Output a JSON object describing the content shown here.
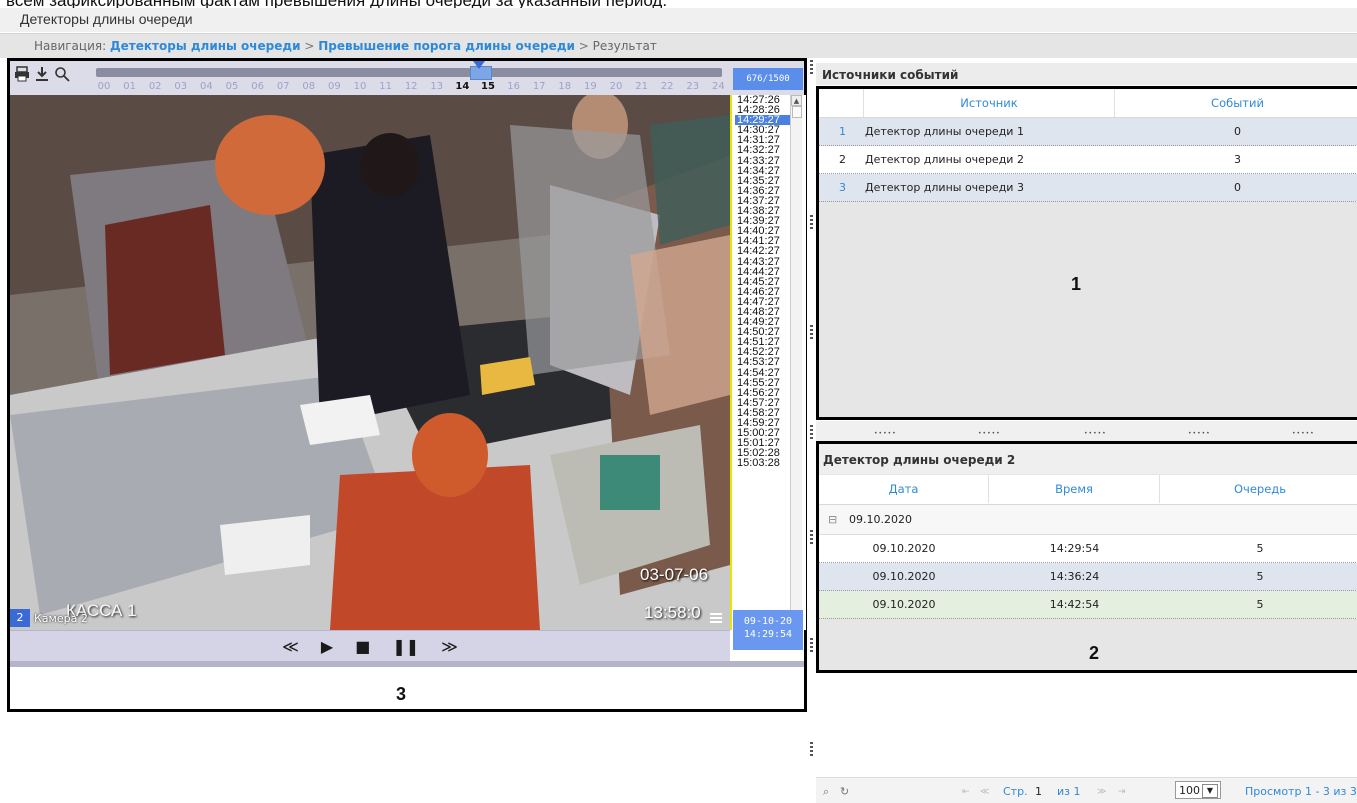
{
  "top_caption": "всем зафиксированным фактам превышения длины очереди за указанный период.",
  "page_title": "Детекторы длины очереди",
  "breadcrumb": {
    "prefix": "Навигация:",
    "link1": "Детекторы длины очереди",
    "sep": ">",
    "link2": "Превышение порога длины очереди",
    "current": "Результат"
  },
  "player": {
    "frame_counter": "676/1500",
    "hours": [
      "00",
      "01",
      "02",
      "03",
      "04",
      "05",
      "06",
      "07",
      "08",
      "09",
      "10",
      "11",
      "12",
      "13",
      "14",
      "15",
      "16",
      "17",
      "18",
      "19",
      "20",
      "21",
      "22",
      "23",
      "24"
    ],
    "highlighted_hours": [
      "14",
      "15"
    ],
    "times": [
      "14:27:26",
      "14:28:26",
      "14:29:27",
      "14:30:27",
      "14:31:27",
      "14:32:27",
      "14:33:27",
      "14:34:27",
      "14:35:27",
      "14:36:27",
      "14:37:27",
      "14:38:27",
      "14:39:27",
      "14:40:27",
      "14:41:27",
      "14:42:27",
      "14:43:27",
      "14:44:27",
      "14:45:27",
      "14:46:27",
      "14:47:27",
      "14:48:27",
      "14:49:27",
      "14:50:27",
      "14:51:27",
      "14:52:27",
      "14:53:27",
      "14:54:27",
      "14:55:27",
      "14:56:27",
      "14:57:27",
      "14:58:27",
      "14:59:27",
      "15:00:27",
      "15:01:27",
      "15:02:28",
      "15:03:28"
    ],
    "selected_time_index": 2,
    "camera_number": "2",
    "camera_name": "Камера 2",
    "osd_kassa": "КАССА 1",
    "osd_date": "03-07-06",
    "osd_time": "13:58:0",
    "timestamp_date": "09-10-20",
    "timestamp_time": "14:29:54",
    "controls": {
      "rewind": "≪",
      "play": "▶",
      "stop": "■",
      "pause": "❚❚",
      "forward": "≫"
    }
  },
  "markers": {
    "one": "1",
    "two": "2",
    "three": "3"
  },
  "sources": {
    "title": "Источники событий",
    "columns": [
      "Источник",
      "Событий"
    ],
    "rows": [
      {
        "num": "1",
        "name": "Детектор длины очереди 1",
        "count": "0"
      },
      {
        "num": "2",
        "name": "Детектор длины очереди 2",
        "count": "3"
      },
      {
        "num": "3",
        "name": "Детектор длины очереди 3",
        "count": "0"
      }
    ]
  },
  "detail": {
    "title": "Детектор длины очереди 2",
    "columns": [
      "Дата",
      "Время",
      "Очередь"
    ],
    "group_toggle": "⊟",
    "group": "09.10.2020",
    "rows": [
      {
        "date": "09.10.2020",
        "time": "14:29:54",
        "queue": "5"
      },
      {
        "date": "09.10.2020",
        "time": "14:36:24",
        "queue": "5"
      },
      {
        "date": "09.10.2020",
        "time": "14:42:54",
        "queue": "5"
      }
    ]
  },
  "pager": {
    "search_icon": "⌕",
    "refresh_icon": "↻",
    "first": "⇤",
    "prev": "≪",
    "page_label": "Стр.",
    "page": "1",
    "of_label": "из 1",
    "next": "≫",
    "last": "⇥",
    "page_size": "100",
    "summary": "Просмотр 1 - 3 из 3"
  },
  "colors": {
    "accent": "#2e8ad8",
    "player_blue": "#5b8dea",
    "selected_row": "#dfe5ef",
    "green_row": "#e4efe0"
  }
}
